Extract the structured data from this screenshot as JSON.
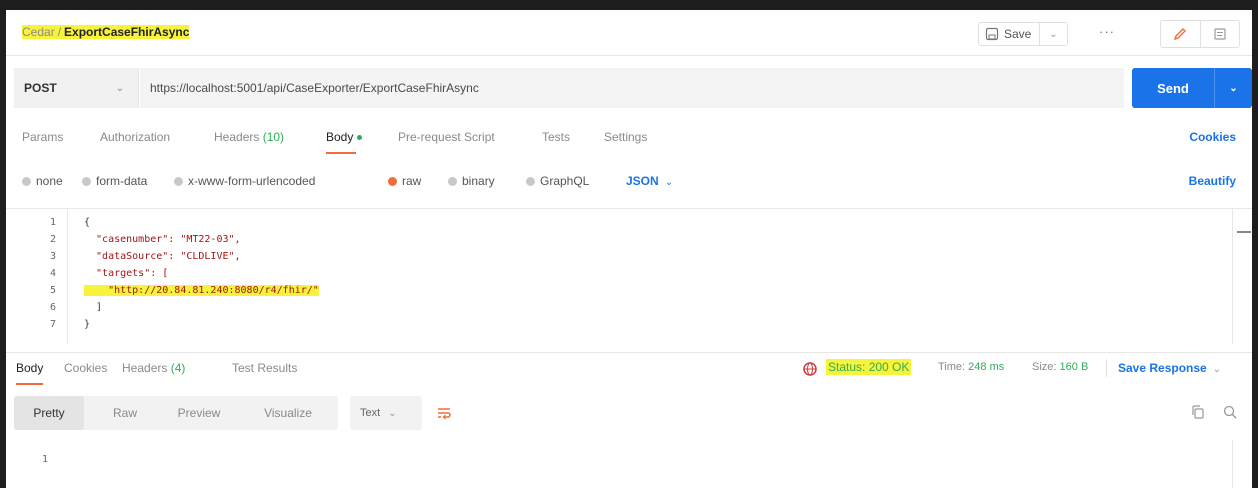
{
  "breadcrumb": {
    "collection": "Cedar",
    "separator": "/",
    "request": "ExportCaseFhirAsync"
  },
  "toolbar": {
    "save_label": "Save",
    "more_label": "···"
  },
  "request": {
    "method": "POST",
    "url": "https://localhost:5001/api/CaseExporter/ExportCaseFhirAsync",
    "send_label": "Send"
  },
  "request_tabs": [
    {
      "label": "Params"
    },
    {
      "label": "Authorization"
    },
    {
      "label": "Headers",
      "count": "(10)"
    },
    {
      "label": "Body"
    },
    {
      "label": "Pre-request Script"
    },
    {
      "label": "Tests"
    },
    {
      "label": "Settings"
    }
  ],
  "cookies_label": "Cookies",
  "body_types": [
    "none",
    "form-data",
    "x-www-form-urlencoded",
    "raw",
    "binary",
    "GraphQL"
  ],
  "body_selected": "raw",
  "body_format": "JSON",
  "beautify_label": "Beautify",
  "editor": {
    "line_numbers": [
      "1",
      "2",
      "3",
      "4",
      "5",
      "6",
      "7"
    ],
    "lines": [
      "{",
      "  \"casenumber\": \"MT22-03\",",
      "  \"dataSource\": \"CLDLIVE\",",
      "  \"targets\": [",
      "    \"http://20.84.81.240:8080/r4/fhir/\"",
      "  ]",
      "}"
    ]
  },
  "response": {
    "tabs": [
      {
        "label": "Body"
      },
      {
        "label": "Cookies"
      },
      {
        "label": "Headers",
        "count": "(4)"
      },
      {
        "label": "Test Results"
      }
    ],
    "status_text": "Status: 200 OK",
    "time_key": "Time:",
    "time_value": "248 ms",
    "size_key": "Size:",
    "size_value": "160 B",
    "save_response_label": "Save Response",
    "views": [
      "Pretty",
      "Raw",
      "Preview",
      "Visualize"
    ],
    "format": "Text",
    "body_line_number": "1"
  },
  "colors": {
    "accent": "#f26b3a",
    "link": "#1a73e8",
    "success": "#2eae5a",
    "highlight": "#f7f23a"
  }
}
